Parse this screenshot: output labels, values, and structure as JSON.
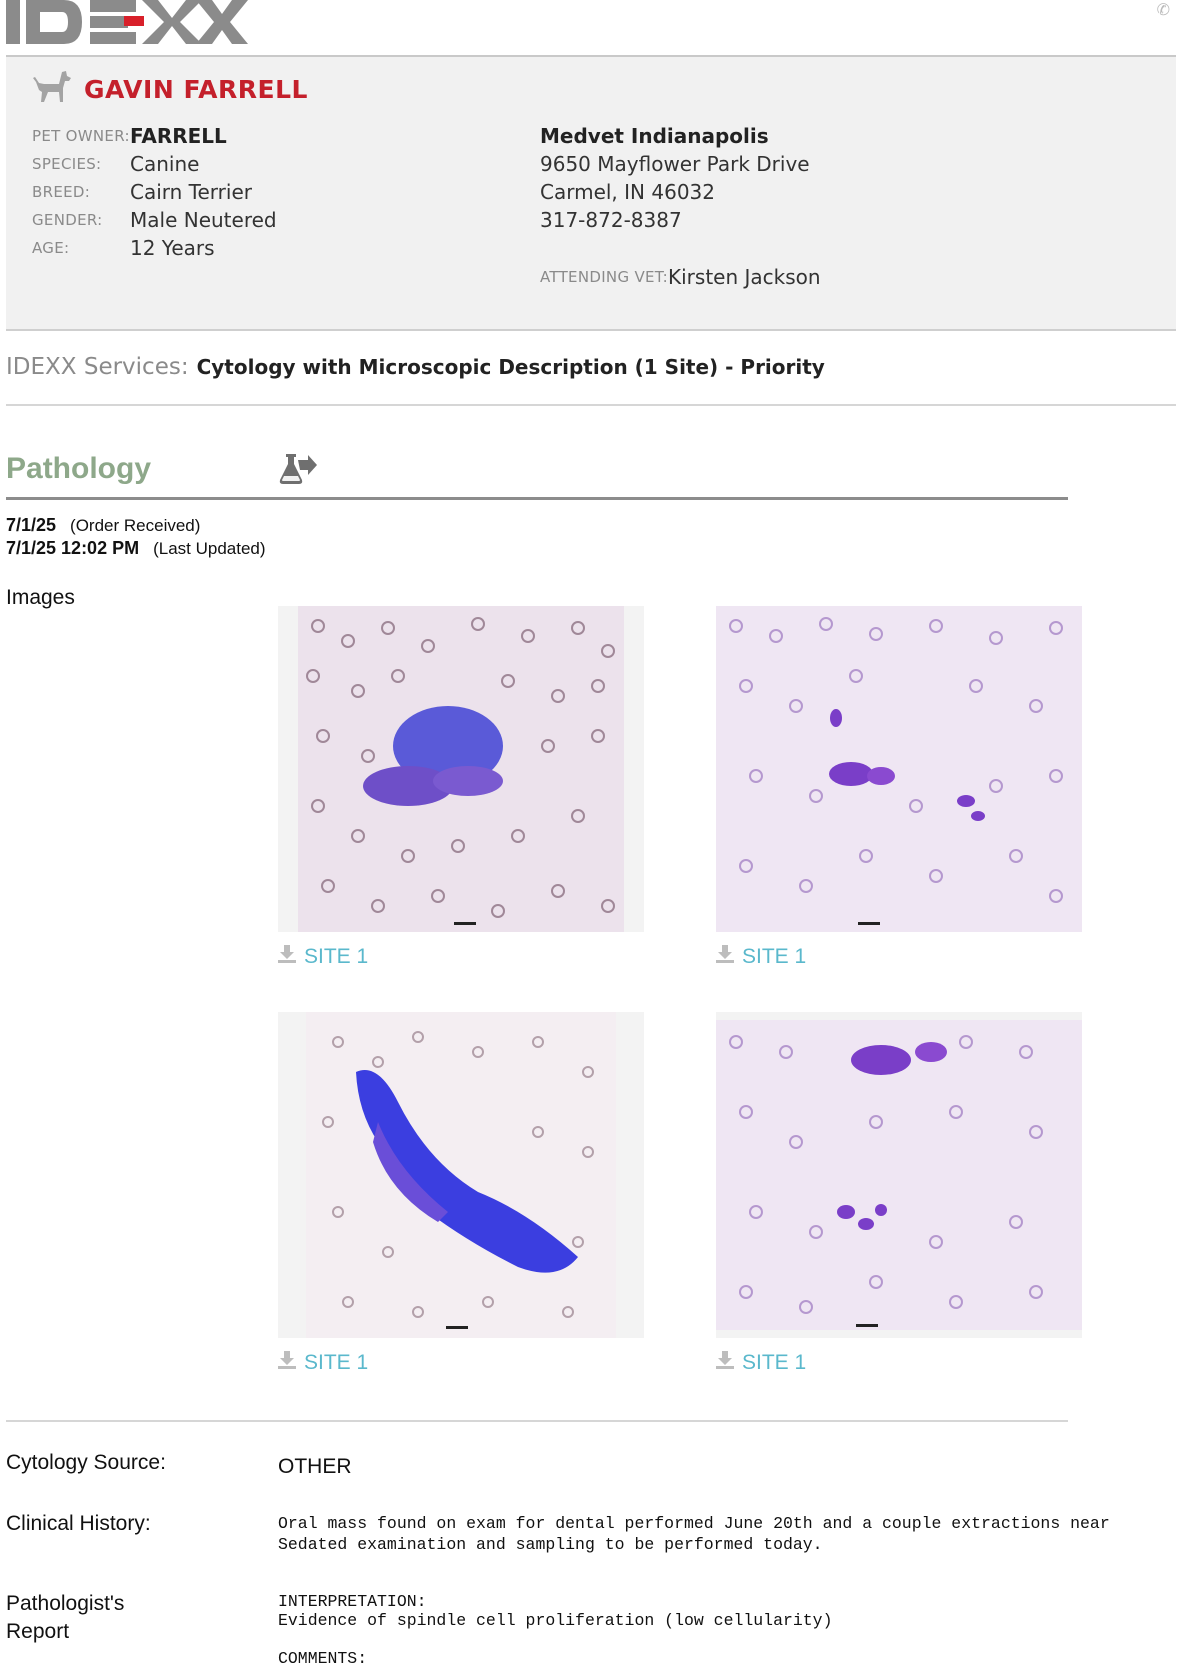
{
  "brand": {
    "name": "IDEXX",
    "accent": "#c4202b"
  },
  "patient": {
    "name": "GAVIN FARRELL",
    "species_icon": "dog-icon",
    "pet_owner_label": "PET OWNER:",
    "pet_owner": "FARRELL",
    "species_label": "SPECIES:",
    "species": "Canine",
    "breed_label": "BREED:",
    "breed": "Cairn Terrier",
    "gender_label": "GENDER:",
    "gender": "Male Neutered",
    "age_label": "AGE:",
    "age": "12 Years"
  },
  "clinic": {
    "name": "Medvet Indianapolis",
    "address1": "9650 Mayflower Park Drive",
    "address2": "Carmel, IN 46032",
    "phone": "317-872-8387",
    "attending_label": "ATTENDING VET:",
    "attending_vet": "Kirsten Jackson"
  },
  "services": {
    "label": "IDEXX Services:",
    "value": "Cytology with Microscopic Description (1 Site) - Priority"
  },
  "pathology": {
    "title": "Pathology",
    "icon": "flask-arrow-icon",
    "order_received_date": "7/1/25",
    "order_received_label": "(Order Received)",
    "last_updated_date": "7/1/25 12:02 PM",
    "last_updated_label": "(Last Updated)",
    "images_label": "Images",
    "images": [
      {
        "caption": "SITE 1"
      },
      {
        "caption": "SITE 1"
      },
      {
        "caption": "SITE 1"
      },
      {
        "caption": "SITE 1"
      }
    ],
    "cytology_source_label": "Cytology Source:",
    "cytology_source": "OTHER",
    "clinical_history_label": "Clinical History:",
    "clinical_history_line1": "Oral mass found on exam for dental performed June 20th and a couple extractions near",
    "clinical_history_line2": "Sedated examination and sampling to be performed today.",
    "report_label_line1": "Pathologist's",
    "report_label_line2": "Report",
    "interpretation_heading": "INTERPRETATION:",
    "interpretation_text": "Evidence of spindle cell proliferation (low cellularity)",
    "comments_heading": "COMMENTS:"
  }
}
